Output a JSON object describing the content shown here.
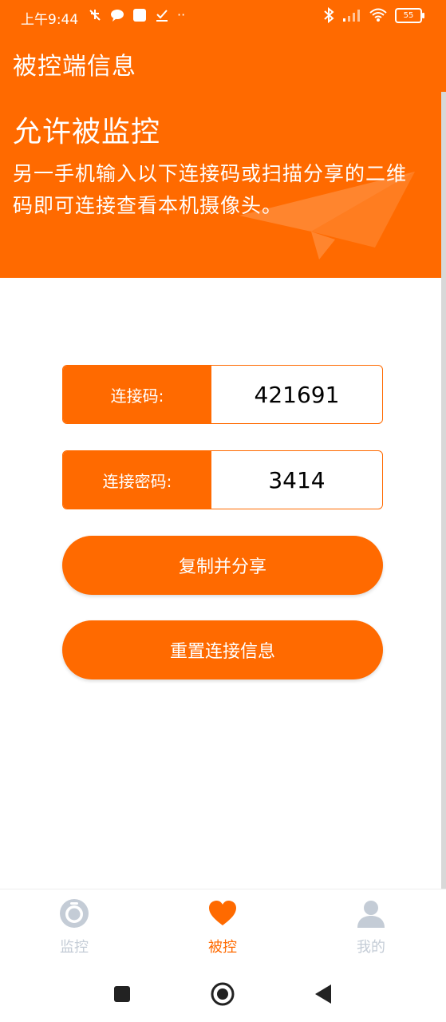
{
  "status_bar": {
    "time": "上午9:44",
    "battery": "55"
  },
  "header": {
    "app_title": "被控端信息",
    "section_title": "允许被监控",
    "description": "另一手机输入以下连接码或扫描分享的二维码即可连接查看本机摄像头。"
  },
  "form": {
    "connect_code_label": "连接码:",
    "connect_code_value": "421691",
    "password_label": "连接密码:",
    "password_value": "3414"
  },
  "buttons": {
    "copy_share": "复制并分享",
    "reset": "重置连接信息"
  },
  "bottom_nav": {
    "items": [
      {
        "label": "监控",
        "icon": "camera-lens-icon"
      },
      {
        "label": "被控",
        "icon": "heart-icon"
      },
      {
        "label": "我的",
        "icon": "user-icon"
      }
    ]
  },
  "colors": {
    "accent": "#ff6a00",
    "inactive": "#c4ccd6"
  }
}
